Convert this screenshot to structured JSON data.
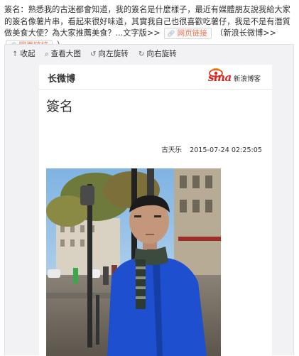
{
  "post": {
    "text_a": "簽名：熟悉我的古迷都會知道，我的簽名是什麼樣子，最近有媒體朋友說我給大家的簽名像薯片串，看起來很好味道，其實我自己也很喜歡吃薯仔，我是不是有潛質做美食大使？為大家推薦美食？...文字版>>",
    "link_label_1": "网页链接",
    "text_b": "（新浪长微博>>",
    "link_label_2": "网页链接",
    "text_c": "）"
  },
  "toolbar": {
    "collapse": "收起",
    "view_large": "查看大图",
    "rotate_left": "向左旋转",
    "rotate_right": "向右旋转"
  },
  "card": {
    "logo": "长微博",
    "brand_word": "sina",
    "brand_cn": "新浪博客",
    "title": "簽名",
    "author": "古天乐",
    "timestamp": "2015-07-24 02:25:05"
  },
  "colors": {
    "link": "#eb7350",
    "sina_red": "#e2221c",
    "jacket_blue": "#1d4fcf"
  },
  "icons": {
    "collapse": "arrow-up-icon",
    "view_large": "magnifier-icon",
    "rotate_left": "rotate-left-icon",
    "rotate_right": "rotate-right-icon",
    "link": "link-icon"
  }
}
